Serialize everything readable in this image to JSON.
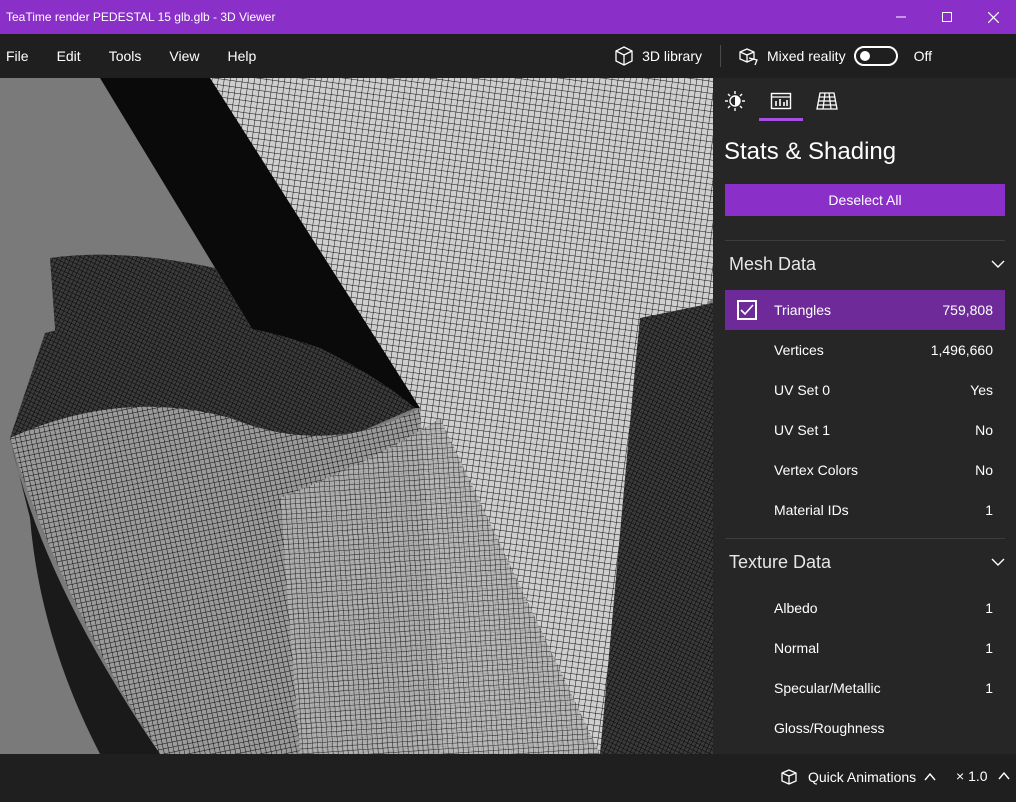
{
  "window": {
    "title": "TeaTime render PEDESTAL 15 glb.glb - 3D Viewer"
  },
  "menu": {
    "items": [
      "File",
      "Edit",
      "Tools",
      "View",
      "Help"
    ],
    "library_label": "3D library",
    "mixed_reality_label": "Mixed reality",
    "mixed_reality_state": "Off"
  },
  "panel": {
    "tabs": [
      "lighting-icon",
      "stats-icon",
      "grid-icon"
    ],
    "active_tab": "stats-icon",
    "title": "Stats & Shading",
    "deselect_label": "Deselect All",
    "mesh": {
      "header": "Mesh Data",
      "rows": [
        {
          "name": "Triangles",
          "value": "759,808",
          "checked": true
        },
        {
          "name": "Vertices",
          "value": "1,496,660"
        },
        {
          "name": "UV Set 0",
          "value": "Yes"
        },
        {
          "name": "UV Set 1",
          "value": "No"
        },
        {
          "name": "Vertex Colors",
          "value": "No"
        },
        {
          "name": "Material IDs",
          "value": "1"
        }
      ]
    },
    "texture": {
      "header": "Texture Data",
      "rows": [
        {
          "name": "Albedo",
          "value": "1"
        },
        {
          "name": "Normal",
          "value": "1"
        },
        {
          "name": "Specular/Metallic",
          "value": "1"
        },
        {
          "name": "Gloss/Roughness",
          "value": ""
        }
      ]
    }
  },
  "bottom": {
    "quick_animations": "Quick Animations",
    "speed": "× 1.0"
  },
  "colors": {
    "accent": "#8a2fc8",
    "selected_row": "#6e2a98",
    "panel_bg": "#262626"
  }
}
